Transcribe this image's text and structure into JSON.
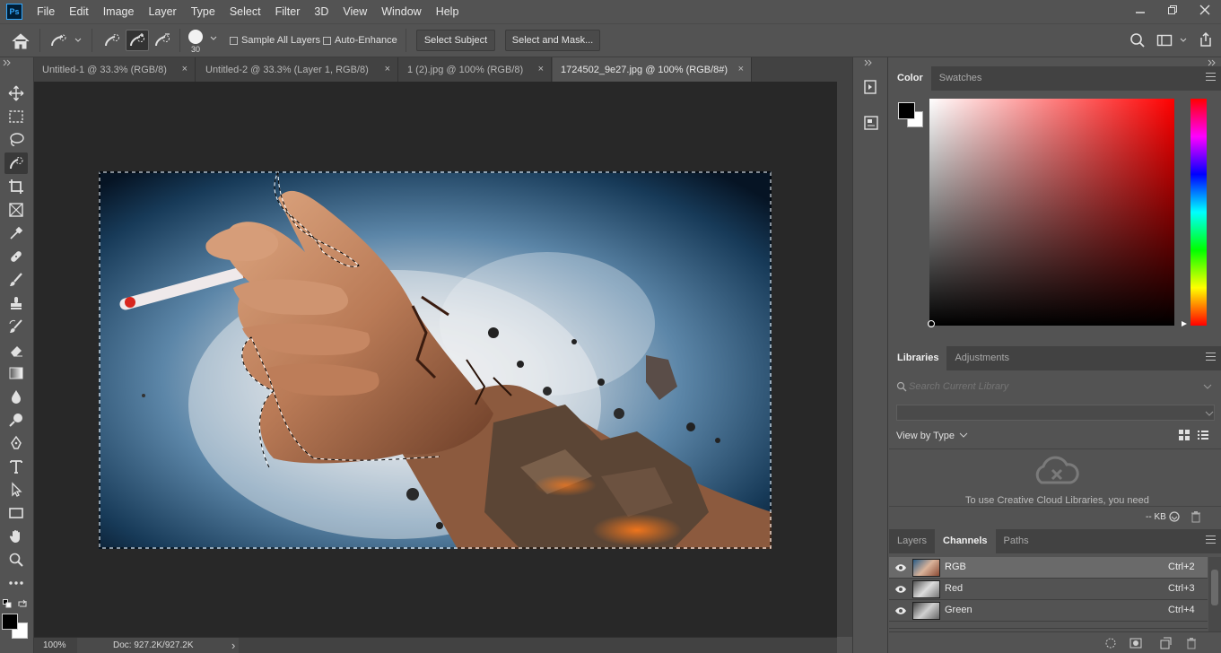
{
  "app": {
    "logo_text": "Ps",
    "menu": [
      "File",
      "Edit",
      "Image",
      "Layer",
      "Type",
      "Select",
      "Filter",
      "3D",
      "View",
      "Window",
      "Help"
    ]
  },
  "options_bar": {
    "brush_size": "30",
    "sample_all_layers": "Sample All Layers",
    "auto_enhance": "Auto-Enhance",
    "select_subject": "Select Subject",
    "select_and_mask": "Select and Mask..."
  },
  "tabs": [
    {
      "label": "Untitled-1 @ 33.3% (RGB/8)"
    },
    {
      "label": "Untitled-2 @ 33.3% (Layer 1, RGB/8)"
    },
    {
      "label": "1 (2).jpg @ 100% (RGB/8)"
    },
    {
      "label": "1724502_9e27.jpg @ 100% (RGB/8#)"
    }
  ],
  "tab_close_glyph": "×",
  "status": {
    "zoom": "100%",
    "doc": "Doc: 927.2K/927.2K",
    "arrow": "›"
  },
  "color_panel": {
    "tabs": [
      "Color",
      "Swatches"
    ],
    "foreground": "#000000",
    "background": "#ffffff",
    "hue_color": "#ff0000"
  },
  "libraries_panel": {
    "tabs": [
      "Libraries",
      "Adjustments"
    ],
    "search_placeholder": "Search Current Library",
    "view_by": "View by Type",
    "message": "To use Creative Cloud Libraries, you need",
    "kb": "-- KB"
  },
  "channels_panel": {
    "tabs": [
      "Layers",
      "Channels",
      "Paths"
    ],
    "channels": [
      {
        "name": "RGB",
        "shortcut": "Ctrl+2"
      },
      {
        "name": "Red",
        "shortcut": "Ctrl+3"
      },
      {
        "name": "Green",
        "shortcut": "Ctrl+4"
      }
    ]
  },
  "colors": {
    "ui_dark": "#535353",
    "canvas_bg": "#282828",
    "accent": "#31a8ff"
  }
}
